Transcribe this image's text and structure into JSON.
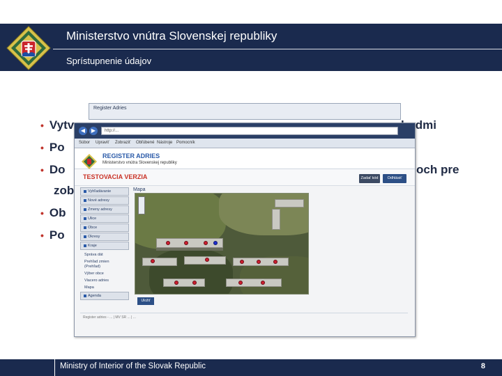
{
  "header": {
    "title": "Ministerstvo vnútra Slovenskej republiky",
    "subtitle": "Sprístupnenie údajov"
  },
  "colors": {
    "navy": "#1a2a4e",
    "bullet_red": "#c0342c",
    "emblem_gold": "#d8c14a",
    "emblem_green": "#2f6b3d"
  },
  "bullets": [
    {
      "text": "Vytv",
      "tail": "hodmi"
    },
    {
      "text": "Po",
      "tail": ""
    },
    {
      "text": "Do",
      "tail": "och pre"
    },
    {
      "text": "zob",
      "tail": ""
    },
    {
      "text": "Ob",
      "tail": ""
    },
    {
      "text": "Po",
      "tail": ""
    }
  ],
  "screenshot": {
    "back_window_title": "Register Adries",
    "address_bar": "http://...",
    "menu": [
      "Súbor",
      "Upraviť",
      "Zobraziť",
      "Obľúbené",
      "Nástroje",
      "Pomocník"
    ],
    "site_name": "REGISTER ADRIES",
    "site_subtitle": "Ministerstvo vnútra Slovenskej republiky",
    "test_label": "TESTOVACIA VERZIA",
    "buttons": {
      "a": "Zadať kód",
      "b": "Odhlásiť"
    },
    "sidebar": [
      "Vyhľadávanie",
      "Nové adresy",
      "Zmeny adresy",
      "Ulice",
      "Obce",
      "Okresy",
      "Kraje"
    ],
    "sidebar_plain": [
      "Správa dát",
      "Prehľad zmien",
      "(Prehľad)",
      "Výber obce",
      "Viacero adries",
      "Mapa"
    ],
    "sidebar_bottom": "Agenda",
    "map_title": "Mapa",
    "submit": "Uložiť",
    "footer_text": "Register adries - ... | MV SR ... | ..."
  },
  "footer": {
    "text": "Ministry of Interior of the Slovak Republic",
    "page_number": "8"
  }
}
